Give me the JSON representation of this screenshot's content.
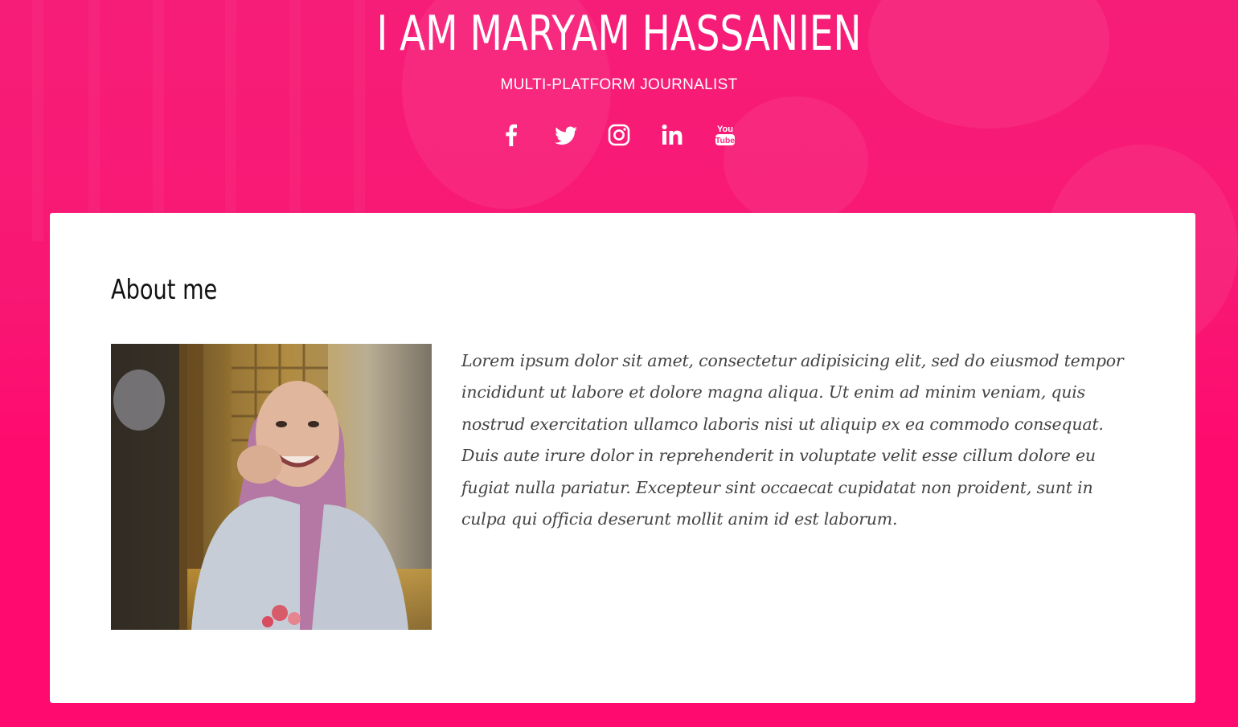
{
  "header": {
    "title": "I AM MARYAM HASSANIEN",
    "subtitle": "MULTI-PLATFORM JOURNALIST"
  },
  "social": [
    {
      "name": "facebook-icon",
      "label": "Facebook"
    },
    {
      "name": "twitter-icon",
      "label": "Twitter"
    },
    {
      "name": "instagram-icon",
      "label": "Instagram"
    },
    {
      "name": "linkedin-icon",
      "label": "LinkedIn"
    },
    {
      "name": "youtube-icon",
      "label": "YouTube"
    }
  ],
  "about": {
    "heading": "About me",
    "text": "Lorem ipsum dolor sit amet, consectetur adipisicing elit, sed do eiusmod tempor incididunt ut labore et dolore magna aliqua. Ut enim ad minim veniam, quis nostrud exercitation ullamco laboris nisi ut aliquip ex ea commodo consequat. Duis aute irure dolor in reprehenderit in voluptate velit esse cillum dolore eu fugiat nulla pariatur. Excepteur sint occaecat cupidatat non proident, sunt in culpa qui officia deserunt mollit anim id est laborum."
  },
  "colors": {
    "background": "#ff0a6e",
    "card": "#ffffff",
    "text": "#444444"
  }
}
